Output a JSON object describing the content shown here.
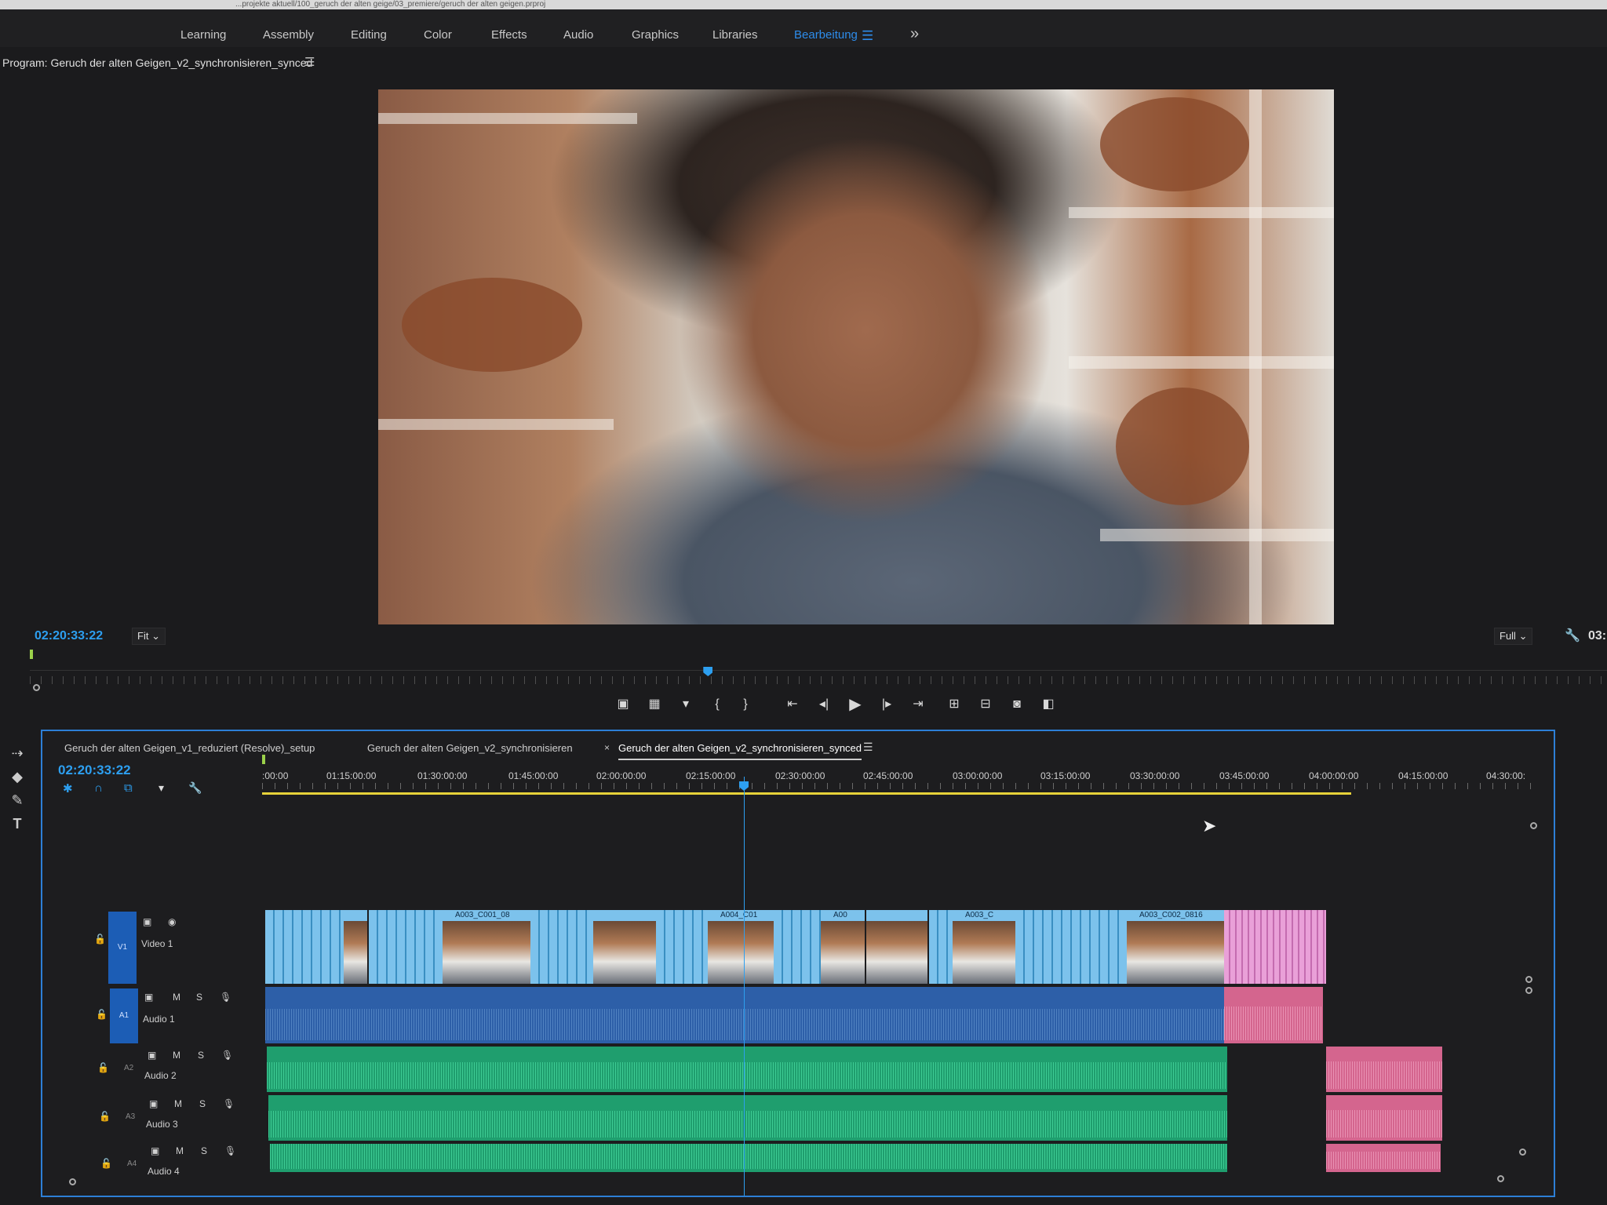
{
  "titlebar": {
    "path": "...projekte aktuell/100_geruch der alten geige/03_premiere/geruch der alten geigen.prproj"
  },
  "workspaces": [
    {
      "label": "Learning"
    },
    {
      "label": "Assembly"
    },
    {
      "label": "Editing"
    },
    {
      "label": "Color"
    },
    {
      "label": "Effects"
    },
    {
      "label": "Audio"
    },
    {
      "label": "Graphics"
    },
    {
      "label": "Libraries"
    },
    {
      "label": "Bearbeitung",
      "active": true
    }
  ],
  "workspace_menu_icon": "hamburger-icon",
  "workspace_overflow_icon": "double-chevron-right-icon",
  "program": {
    "title": "Program: Geruch der alten Geigen_v2_synchronisieren_synced",
    "menu_icon": "hamburger-icon",
    "timecode": "02:20:33:22",
    "zoom": "Fit",
    "resolution": "Full",
    "duration_partial": "03:",
    "settings_icon": "wrench-icon",
    "playhead_fraction": 0.43
  },
  "transport": [
    {
      "icon": "safe-margins-icon"
    },
    {
      "icon": "compare-view-icon"
    },
    {
      "icon": "marker-icon"
    },
    {
      "icon": "mark-in-icon"
    },
    {
      "icon": "mark-out-icon"
    },
    {
      "icon": "go-to-in-icon"
    },
    {
      "icon": "step-back-icon"
    },
    {
      "icon": "play-icon"
    },
    {
      "icon": "step-forward-icon"
    },
    {
      "icon": "go-to-out-icon"
    },
    {
      "icon": "lift-icon"
    },
    {
      "icon": "extract-icon"
    },
    {
      "icon": "export-frame-icon"
    },
    {
      "icon": "compare-icon"
    }
  ],
  "timeline": {
    "tabs": [
      {
        "label": "Geruch der alten Geigen_v1_reduziert (Resolve)_setup"
      },
      {
        "label": "Geruch der alten Geigen_v2_synchronisieren"
      },
      {
        "label": "Geruch der alten Geigen_v2_synchronisieren_synced",
        "active": true
      }
    ],
    "close_icon": "close-icon",
    "menu_icon": "hamburger-icon",
    "timecode": "02:20:33:22",
    "ruler": [
      ":00:00",
      "01:15:00:00",
      "01:30:00:00",
      "01:45:00:00",
      "02:00:00:00",
      "02:15:00:00",
      "02:30:00:00",
      "02:45:00:00",
      "03:00:00:00",
      "03:15:00:00",
      "03:30:00:00",
      "03:45:00:00",
      "04:00:00:00",
      "04:15:00:00",
      "04:30:00:"
    ],
    "tracks": [
      {
        "id": "V1",
        "name": "Video 1",
        "type": "video"
      },
      {
        "id": "A1",
        "name": "Audio 1",
        "type": "audio"
      },
      {
        "id": "A2",
        "name": "Audio 2",
        "type": "audio"
      },
      {
        "id": "A3",
        "name": "Audio 3",
        "type": "audio"
      },
      {
        "id": "A4",
        "name": "Audio 4",
        "type": "audio"
      }
    ],
    "track_buttons": {
      "mute": "M",
      "solo": "S"
    },
    "clip_labels": [
      "A003_C001_08",
      "A004_C01",
      "A00",
      "A003_C",
      "A003_C002_0816"
    ]
  },
  "tools": [
    "track-select-icon",
    "razor-icon",
    "pen-icon",
    "text-tool-icon"
  ],
  "colors": {
    "accent": "#2d9ff0",
    "video_clip": "#7cc2ec",
    "audio1_clip": "#2d5fa8",
    "audio_green": "#1f9e6e",
    "pink": "#d4658e",
    "workarea": "#e6d23a"
  }
}
